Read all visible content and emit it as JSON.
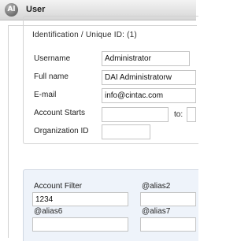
{
  "window": {
    "icon_letter": "Al",
    "title": "User"
  },
  "identification": {
    "legend": "Identification / Unique ID: (1)",
    "username": {
      "label": "Username",
      "value": "Administrator"
    },
    "full_name": {
      "label": "Full name",
      "value": "DAI Administratorw"
    },
    "email": {
      "label": "E-mail",
      "value": "info@cintac.com"
    },
    "account_starts": {
      "label": "Account Starts",
      "value": "",
      "to_label": "to:",
      "to_value": ""
    },
    "organization_id": {
      "label": "Organization ID",
      "value": ""
    }
  },
  "filters": {
    "account_filter": {
      "label": "Account Filter",
      "value": "1234"
    },
    "alias2": {
      "label": "@alias2",
      "value": ""
    },
    "alias6": {
      "label": "@alias6",
      "value": ""
    },
    "alias7": {
      "label": "@alias7",
      "value": ""
    }
  }
}
